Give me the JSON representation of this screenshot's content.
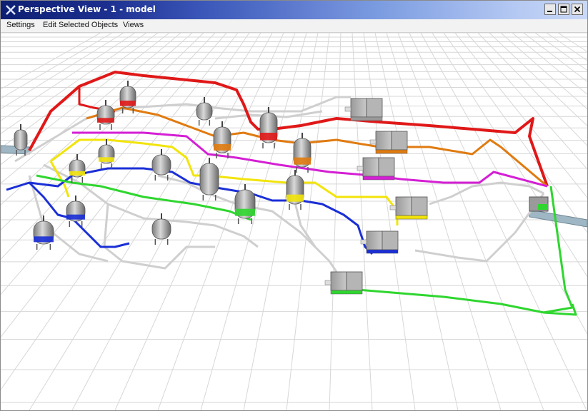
{
  "window": {
    "title": "Perspective View - 1 - model"
  },
  "menu": {
    "items": [
      "Settings",
      "Edit Selected Objects",
      "Views"
    ]
  },
  "icons": {
    "app": "app-x-icon",
    "minimize": "minimize-icon",
    "maximize": "maximize-icon",
    "close": "close-icon"
  },
  "colors": {
    "titlebar_start": "#0d1f72",
    "titlebar_end": "#c9d8f7",
    "grid_line": "#d7d7d7",
    "pipe_red": "#e01818",
    "pipe_orange": "#e07b10",
    "pipe_magenta": "#d41fd4",
    "pipe_yellow": "#f2e40a",
    "pipe_blue": "#1a2fd6",
    "pipe_green": "#2fd62f",
    "pipe_gray": "#cfcfcf"
  }
}
